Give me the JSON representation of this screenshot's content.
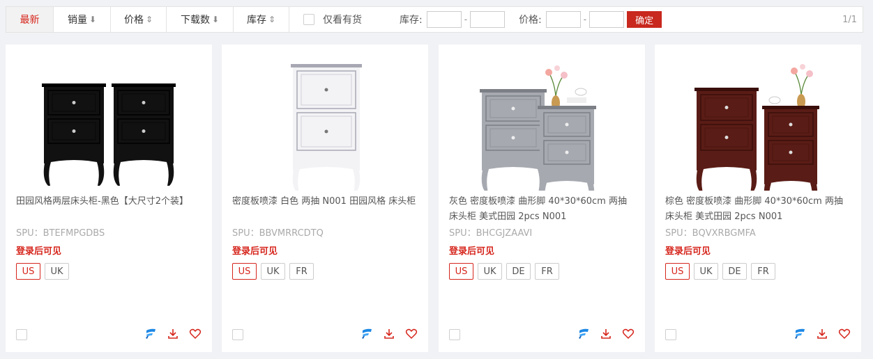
{
  "toolbar": {
    "tabs": [
      {
        "label": "最新",
        "arrow": ""
      },
      {
        "label": "销量",
        "arrow": "⬇"
      },
      {
        "label": "价格",
        "arrow": "⇕"
      },
      {
        "label": "下载数",
        "arrow": "⬇"
      },
      {
        "label": "库存",
        "arrow": "⇕"
      }
    ],
    "instock_label": "仅看有货",
    "stock_label": "库存:",
    "price_label": "价格:",
    "dash": "-",
    "confirm_label": "确定",
    "pager": "1/1"
  },
  "products": [
    {
      "title": "田园风格两层床头柜-黑色【大尺寸2个装】",
      "spu": "SPU：BTEFMPGDBS",
      "login_text": "登录后可见",
      "sites": [
        "US",
        "UK"
      ],
      "color": "black"
    },
    {
      "title": "密度板喷漆 白色 两抽 N001 田园风格 床头柜",
      "spu": "SPU：BBVMRRCDTQ",
      "login_text": "登录后可见",
      "sites": [
        "US",
        "UK",
        "FR"
      ],
      "color": "white"
    },
    {
      "title": "灰色 密度板喷漆 曲形脚 40*30*60cm 两抽 床头柜 美式田园 2pcs N001",
      "spu": "SPU：BHCGJZAAVI",
      "login_text": "登录后可见",
      "sites": [
        "US",
        "UK",
        "DE",
        "FR"
      ],
      "color": "gray"
    },
    {
      "title": "棕色 密度板喷漆 曲形脚 40*30*60cm 两抽 床头柜 美式田园 2pcs N001",
      "spu": "SPU：BQVXRBGMFA",
      "login_text": "登录后可见",
      "sites": [
        "US",
        "UK",
        "DE",
        "FR"
      ],
      "color": "brown"
    }
  ],
  "icons": {
    "brand": "brand-f-icon",
    "download": "download-icon",
    "favorite": "heart-icon"
  },
  "colors": {
    "accent": "#d6251c",
    "confirm": "#c8281e",
    "brand_blue": "#1e88e5"
  }
}
